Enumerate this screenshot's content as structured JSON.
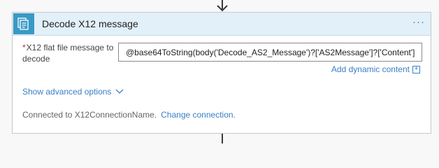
{
  "card": {
    "title": "Decode X12 message",
    "header_icon": "document-stack-icon",
    "menu_label": "···",
    "colors": {
      "header_bg": "#e2f0fa",
      "icon_bg": "#3999c6",
      "link": "#3a7fc6",
      "required": "#c3252b"
    }
  },
  "field": {
    "required_marker": "*",
    "label": "X12 flat file message to decode",
    "value": "@base64ToString(body('Decode_AS2_Message')?['AS2Message']?['Content'])"
  },
  "dynamic_content": {
    "label": "Add dynamic content",
    "icon": "+"
  },
  "advanced": {
    "label": "Show advanced options",
    "icon": "chevron-down-icon"
  },
  "connection": {
    "status_text": "Connected to X12ConnectionName.",
    "change_label": "Change connection."
  }
}
